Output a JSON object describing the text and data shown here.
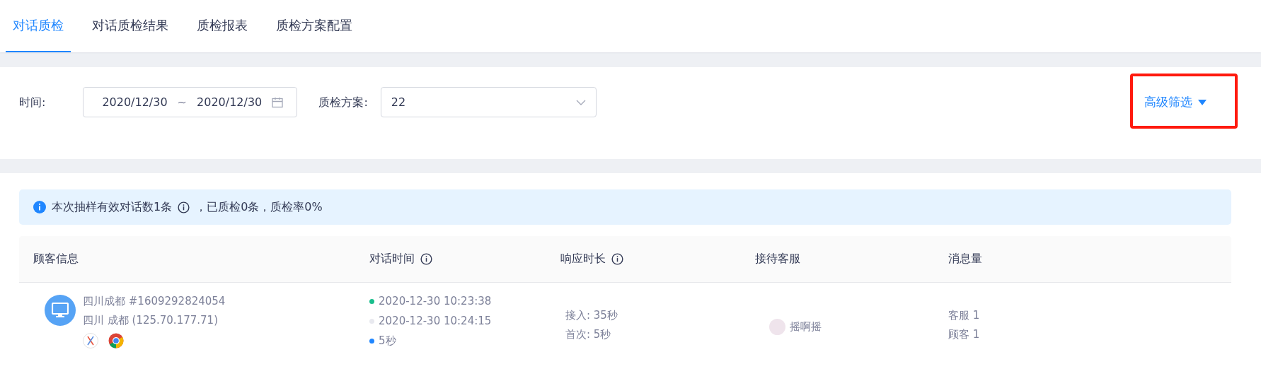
{
  "tabs": [
    {
      "label": "对话质检",
      "selected": true
    },
    {
      "label": "对话质检结果",
      "selected": false
    },
    {
      "label": "质检报表",
      "selected": false
    },
    {
      "label": "质检方案配置",
      "selected": false
    }
  ],
  "filters": {
    "time_label": "时间:",
    "date_start": "2020/12/30",
    "date_separator": "~",
    "date_end": "2020/12/30",
    "plan_label": "质检方案:",
    "plan_value": "22",
    "advanced_filter": "高级筛选"
  },
  "notice": {
    "before": "本次抽样有效对话数1条",
    "after": "，已质检0条，质检率0%"
  },
  "table": {
    "columns": [
      {
        "label": "顾客信息",
        "info": false
      },
      {
        "label": "对话时间",
        "info": true
      },
      {
        "label": "响应时长",
        "info": true
      },
      {
        "label": "接待客服",
        "info": false
      },
      {
        "label": "消息量",
        "info": false
      }
    ],
    "rows": [
      {
        "customer_name": "四川成都 #1609292824054",
        "customer_location": "四川 成都 (125.70.177.71)",
        "times": [
          {
            "text": "2020-12-30 10:23:38",
            "color": "#19be8c"
          },
          {
            "text": "2020-12-30 10:24:15",
            "color": "#e8e9ef"
          },
          {
            "text": "5秒",
            "color": "#1f86ff"
          }
        ],
        "response": [
          "接入: 35秒",
          "首次: 5秒"
        ],
        "agent": "摇啊摇",
        "messages": [
          "客服 1",
          "顾客 1"
        ]
      }
    ]
  }
}
